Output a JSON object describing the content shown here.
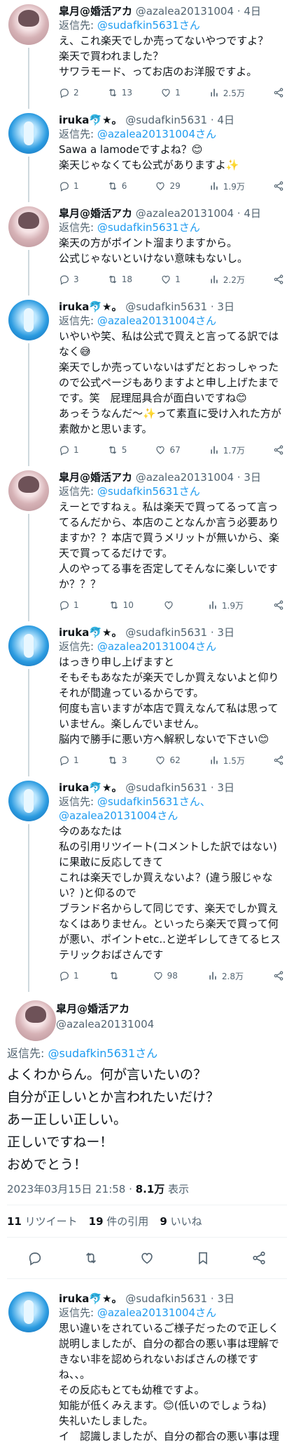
{
  "users": {
    "a": {
      "name": "皐月@婚活アカ",
      "handle": "@azalea20131004"
    },
    "i": {
      "name": "iruka🐬★。",
      "handle": "@sudafkin5631"
    }
  },
  "reply_label": "返信先: ",
  "reply_suffix": "さん",
  "tweets": [
    {
      "user": "a",
      "time": "4日",
      "reply_to": "@sudafkin5631",
      "reply_to2": "",
      "text": "え、これ楽天でしか売ってないやつですよ？\n楽天で買われました？\nサワラモード、ってお店のお洋服ですよ。",
      "replies": "2",
      "retweets": "13",
      "likes": "1",
      "views": "2.5万"
    },
    {
      "user": "i",
      "time": "4日",
      "reply_to": "@azalea20131004",
      "reply_to2": "",
      "text": "Sawa a lamodeですよね？😊\n楽天じゃなくても公式がありますよ✨",
      "replies": "1",
      "retweets": "6",
      "likes": "29",
      "views": "1.9万"
    },
    {
      "user": "a",
      "time": "4日",
      "reply_to": "@sudafkin5631",
      "reply_to2": "",
      "text": "楽天の方がポイント溜まりますから。\n公式じゃないといけない意味もないし。",
      "replies": "3",
      "retweets": "18",
      "likes": "1",
      "views": "2.2万"
    },
    {
      "user": "i",
      "time": "3日",
      "reply_to": "@azalea20131004",
      "reply_to2": "",
      "text": "いやいや笑、私は公式で買えと言ってる訳ではなく😅\n楽天でしか売っていないはずだとおっしゃったので公式ページもありますよと申し上げたまでです。笑　屁理屈具合が面白いですね😊\nあっそうなんだ〜✨って素直に受け入れた方が素敵かと思います。",
      "replies": "1",
      "retweets": "5",
      "likes": "67",
      "views": "1.7万"
    },
    {
      "user": "a",
      "time": "3日",
      "reply_to": "@sudafkin5631",
      "reply_to2": "",
      "text": "えーとですねぇ。私は楽天で買ってるって言ってるんだから、本店のことなんか言う必要ありますか？？本店で買うメリットが無いから、楽天で買ってるだけです。\n人のやってる事を否定してそんなに楽しいですか？？？",
      "replies": "1",
      "retweets": "10",
      "likes": "",
      "views": "1.9万"
    },
    {
      "user": "i",
      "time": "3日",
      "reply_to": "@azalea20131004",
      "reply_to2": "",
      "text": "はっきり申し上げますと\nそもそもあなたが楽天でしか買えないよと仰りそれが間違っているからです。\n何度も言いますが本店で買えなんて私は思っていません。楽しんでいません。\n脳内で勝手に悪い方へ解釈しないで下さい😊",
      "replies": "1",
      "retweets": "3",
      "likes": "62",
      "views": "1.5万"
    },
    {
      "user": "i",
      "time": "3日",
      "reply_to": "@sudafkin5631",
      "reply_to2": "@azalea20131004",
      "text": "今のあなたは\n私の引用リツイート(コメントした訳ではない)に果敢に反応してきて\nこれは楽天でしか買えないよ？(違う服じゃない？)と仰るので\nブランド名からして同じです、楽天でしか買えなくはありません。といったら楽天で買って何が悪い、ポイントetc..と逆ギレしてきてるヒステリックおばさんです",
      "replies": "1",
      "retweets": "",
      "likes": "98",
      "views": "2.8万"
    }
  ],
  "main": {
    "user": "a",
    "reply_to": "@sudafkin5631",
    "lines": [
      "よくわからん。何が言いたいの？",
      "自分が正しいとか言われたいだけ？",
      "あー正しい正しい。",
      "正しいですねー！",
      "おめでとう！"
    ],
    "datetime": "2023年03月15日 21:58",
    "views_num": "8.1万",
    "views_label": " 表示",
    "retweets_num": "11",
    "retweets_label": " リツイート",
    "quotes_num": "19",
    "quotes_label": " 件の引用",
    "likes_num": "9",
    "likes_label": " いいね"
  },
  "last": {
    "user": "i",
    "time": "3日",
    "reply_to": "@azalea20131004",
    "text": "思い違いをされているご様子だったので正しく説明しましたが、自分の都合の悪い事は理解できない非を認められないおばさんの様ですね、、。\nその反応もとても幼稚ですよ。\n知能が低くみえます。😊(低いのでしょうね)\n失礼いたしました。\nイ　認識しましたが、自分の都合の悪い事は理"
  }
}
